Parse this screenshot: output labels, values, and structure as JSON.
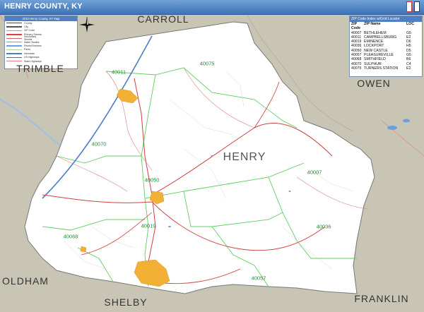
{
  "header": {
    "title": "HENRY COUNTY, KY"
  },
  "logo": {
    "part1": "",
    "part2": ""
  },
  "legend": {
    "title": "2010 Henry County, KY Map",
    "rows": [
      {
        "label": "County",
        "color": "#444444"
      },
      {
        "label": "City",
        "color": "#555555"
      },
      {
        "label": "ZIP Code",
        "color": "#5fcf5f"
      },
      {
        "label": "Primary Streets",
        "color": "#e04040"
      },
      {
        "label": "Secondary Streets",
        "color": "#cc6666"
      },
      {
        "label": "Water Bodies",
        "color": "#6aa0e0"
      },
      {
        "label": "Rivers/Streams",
        "color": "#6aa0e0"
      },
      {
        "label": "Parks",
        "color": "#a8d48a"
      },
      {
        "label": "Interstate",
        "color": "#4a7ec9"
      },
      {
        "label": "US Highways",
        "color": "#d04040"
      },
      {
        "label": "State Highways",
        "color": "#e08080"
      }
    ]
  },
  "zip_table": {
    "title": "ZIP Code Index w/Grid Locator",
    "headers": [
      "ZIP Code",
      "ZIP Name",
      "LOC"
    ],
    "rows": [
      [
        "40007",
        "BETHLEHEM",
        "G5"
      ],
      [
        "40011",
        "CAMPBELLSBURG",
        "E2"
      ],
      [
        "40019",
        "EMINENCE",
        "D6"
      ],
      [
        "40036",
        "LOCKPORT",
        "H5"
      ],
      [
        "40050",
        "NEW CASTLE",
        "D5"
      ],
      [
        "40057",
        "PLEASUREVILLE",
        "G5"
      ],
      [
        "40068",
        "SMITHFIELD",
        "B6"
      ],
      [
        "40070",
        "SULPHUR",
        "C4"
      ],
      [
        "40075",
        "TURNERS STATION",
        "E2"
      ]
    ]
  },
  "map": {
    "counties": [
      {
        "name": "CARROLL",
        "key": "carroll"
      },
      {
        "name": "TRIMBLE",
        "key": "trimble"
      },
      {
        "name": "OWEN",
        "key": "owen"
      },
      {
        "name": "HENRY",
        "key": "henry"
      },
      {
        "name": "OLDHAM",
        "key": "oldham"
      },
      {
        "name": "SHELBY",
        "key": "shelby"
      },
      {
        "name": "FRANKLIN",
        "key": "franklin"
      }
    ],
    "zip_labels": [
      {
        "code": "40075",
        "key": "z40075"
      },
      {
        "code": "40011",
        "key": "z40011"
      },
      {
        "code": "40070",
        "key": "z40070"
      },
      {
        "code": "40050",
        "key": "z40050"
      },
      {
        "code": "40007",
        "key": "z40007"
      },
      {
        "code": "40036",
        "key": "z40036"
      },
      {
        "code": "40019",
        "key": "z40019"
      },
      {
        "code": "40068",
        "key": "z40068"
      },
      {
        "code": "40057",
        "key": "z40057"
      }
    ],
    "colors": {
      "county_fill": "#ffffff",
      "outside": "#c9c5b5",
      "zip_boundary": "#5fcf5f",
      "roads": "#d04040",
      "water": "#6aa0e0",
      "urban": "#f2b035"
    }
  }
}
